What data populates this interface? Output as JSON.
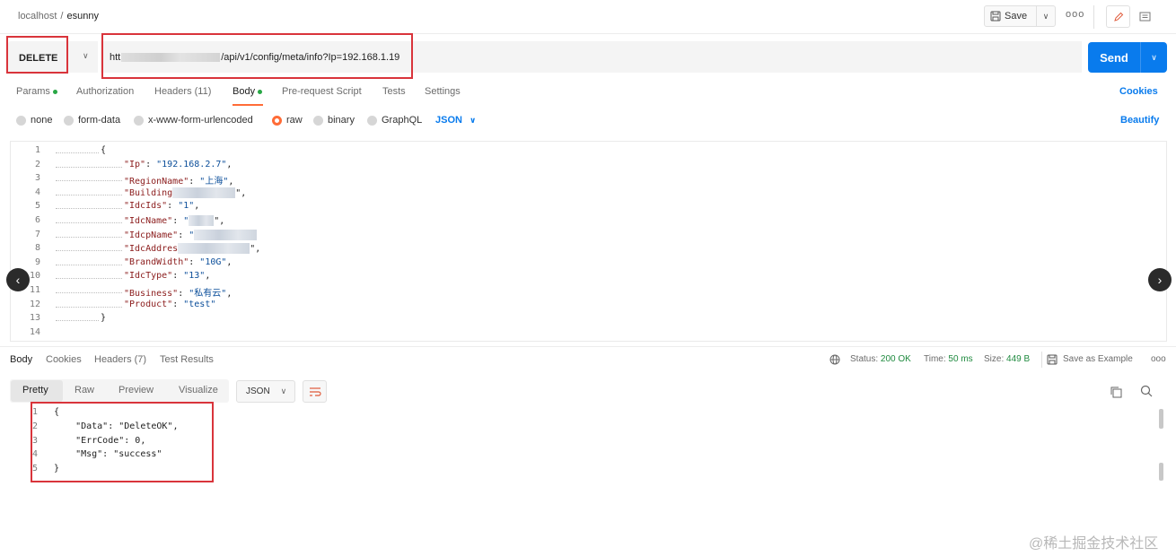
{
  "header": {
    "breadcrumb_root": "localhost",
    "breadcrumb_sep": "/",
    "breadcrumb_current": "esunny",
    "save_label": "Save",
    "more": "ooo"
  },
  "request": {
    "method": "DELETE",
    "url_prefix": "htt",
    "url_suffix": "/api/v1/config/meta/info?Ip=192.168.1.19",
    "send_label": "Send"
  },
  "tabs": [
    {
      "label": "Params",
      "dot": true
    },
    {
      "label": "Authorization",
      "dot": false
    },
    {
      "label": "Headers (11)",
      "dot": false
    },
    {
      "label": "Body",
      "dot": true
    },
    {
      "label": "Pre-request Script",
      "dot": false
    },
    {
      "label": "Tests",
      "dot": false
    },
    {
      "label": "Settings",
      "dot": false
    }
  ],
  "cookies_link": "Cookies",
  "beautify_link": "Beautify",
  "body_types": [
    "none",
    "form-data",
    "x-www-form-urlencoded",
    "raw",
    "binary",
    "GraphQL"
  ],
  "body_format": "JSON",
  "request_body": [
    {
      "n": "1",
      "text": "{"
    },
    {
      "n": "2",
      "key": "\"Ip\"",
      "val": "\"192.168.2.7\"",
      "tail": ","
    },
    {
      "n": "3",
      "key": "\"RegionName\"",
      "val": "\"上海\"",
      "tail": ","
    },
    {
      "n": "4",
      "key": "\"Building",
      "val": "",
      "tail": "\","
    },
    {
      "n": "5",
      "key": "\"IdcIds\"",
      "val": "\"1\"",
      "tail": ","
    },
    {
      "n": "6",
      "key": "\"IdcName\"",
      "val": "\"",
      "tail": "\","
    },
    {
      "n": "7",
      "key": "\"IdcpName\"",
      "val": "\"",
      "tail": ""
    },
    {
      "n": "8",
      "key": "\"IdcAddres",
      "val": "",
      "tail": "\","
    },
    {
      "n": "9",
      "key": "\"BrandWidth\"",
      "val": "\"10G\"",
      "tail": ","
    },
    {
      "n": "10",
      "key": "\"IdcType\"",
      "val": "\"13\"",
      "tail": ","
    },
    {
      "n": "11",
      "key": "\"Business\"",
      "val": "\"私有云\"",
      "tail": ","
    },
    {
      "n": "12",
      "key": "\"Product\"",
      "val": "\"test\"",
      "tail": ""
    },
    {
      "n": "13",
      "text": "}"
    },
    {
      "n": "14",
      "text": ""
    }
  ],
  "response_tabs": [
    "Body",
    "Cookies",
    "Headers (7)",
    "Test Results"
  ],
  "status": {
    "status_label": "Status:",
    "status_value": "200 OK",
    "time_label": "Time:",
    "time_value": "50 ms",
    "size_label": "Size:",
    "size_value": "449 B",
    "save_example": "Save as Example",
    "more": "ooo"
  },
  "view_modes": [
    "Pretty",
    "Raw",
    "Preview",
    "Visualize"
  ],
  "response_format": "JSON",
  "response_body": [
    {
      "n": "1",
      "text": "{"
    },
    {
      "n": "2",
      "text": "    \"Data\": \"DeleteOK\","
    },
    {
      "n": "3",
      "text": "    \"ErrCode\": 0,"
    },
    {
      "n": "4",
      "text": "    \"Msg\": \"success\""
    },
    {
      "n": "5",
      "text": "}"
    }
  ],
  "watermark": "@稀土掘金技术社区",
  "colors": {
    "accent": "#ff6c37",
    "send": "#097bed",
    "highlight_box": "#d9343b",
    "status_ok": "#1f8a3f"
  }
}
